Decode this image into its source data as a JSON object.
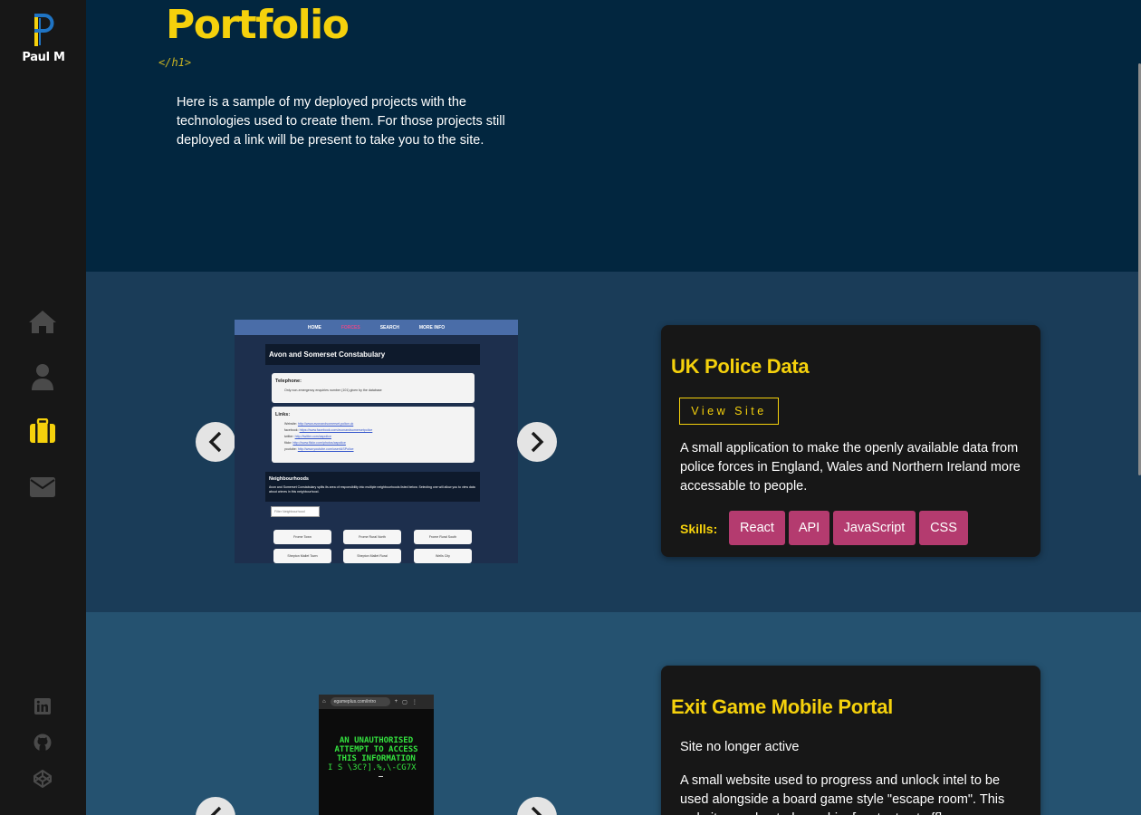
{
  "sidebar": {
    "logo_name": "Paul M",
    "nav": [
      {
        "icon": "home-icon",
        "active": false
      },
      {
        "icon": "user-icon",
        "active": false
      },
      {
        "icon": "briefcase-icon",
        "active": true
      },
      {
        "icon": "envelope-icon",
        "active": false
      }
    ],
    "social": [
      {
        "icon": "linkedin-icon"
      },
      {
        "icon": "github-icon"
      },
      {
        "icon": "codepen-icon"
      }
    ],
    "colors": {
      "bg": "#171717",
      "icon": "#4a4a4a",
      "active": "#f5d10c"
    }
  },
  "header": {
    "title": "Portfolio",
    "code_tag": "</h1>",
    "intro": "Here is a sample of my deployed projects with the technologies used to create them. For those projects still deployed a link will be present to take you to the site."
  },
  "projects": [
    {
      "title": "UK Police Data",
      "view_button": "View Site",
      "description": "A small application to make the openly available data from police forces in England, Wales and Northern Ireland more accessable to people.",
      "skills_label": "Skills:",
      "skills": [
        "React",
        "API",
        "JavaScript",
        "CSS"
      ],
      "preview": {
        "nav": [
          "HOME",
          "FORCES",
          "SEARCH",
          "MORE INFO"
        ],
        "heading": "Avon and Somerset Constabulary",
        "telephone_label": "Telephone:",
        "telephone_line": "Only non-emergency enquiries number (101) given by the database",
        "links_label": "Links:",
        "links": [
          {
            "name": "Website:",
            "url": "http://www.avonandsomerset.police.uk"
          },
          {
            "name": "facebook:",
            "url": "https://www.facebook.com/avonandsomersetpolice"
          },
          {
            "name": "twitter:",
            "url": "http://twitter.com/aspolice"
          },
          {
            "name": "flickr:",
            "url": "http://www.flickr.com/photos/aspolice"
          },
          {
            "name": "youtube:",
            "url": "http://www.youtube.com/user/ASPolice"
          }
        ],
        "neighbourhoods_label": "Neighbourhoods",
        "neighbourhoods_text": "Avon and Somerset Constabulary splits its area of responsibility into multiple neighbourhoods listed below. Selecting one will allow you to view data about crimes in this neighbourhood.",
        "filter_placeholder": "Filter Neighbourhood",
        "buttons": [
          "Frome Town",
          "Frome Rural North",
          "Frome Rural South",
          "Shepton Mallet Town",
          "Shepton Mallet Rural",
          "Wells City"
        ]
      }
    },
    {
      "title": "Exit Game Mobile Portal",
      "status": "Site no longer active",
      "description": "A small website used to progress and unlock intel to be used alongside a board game style \"escape room\". This website was hosted on a bi... [content cut off]",
      "preview": {
        "url": "egameplus.com/intro",
        "lines": [
          "AN UNAUTHORISED",
          "ATTEMPT TO ACCESS",
          "THIS INFORMATION"
        ],
        "glitch": "I S   \\3C?].%,\\-CG7X"
      }
    }
  ]
}
